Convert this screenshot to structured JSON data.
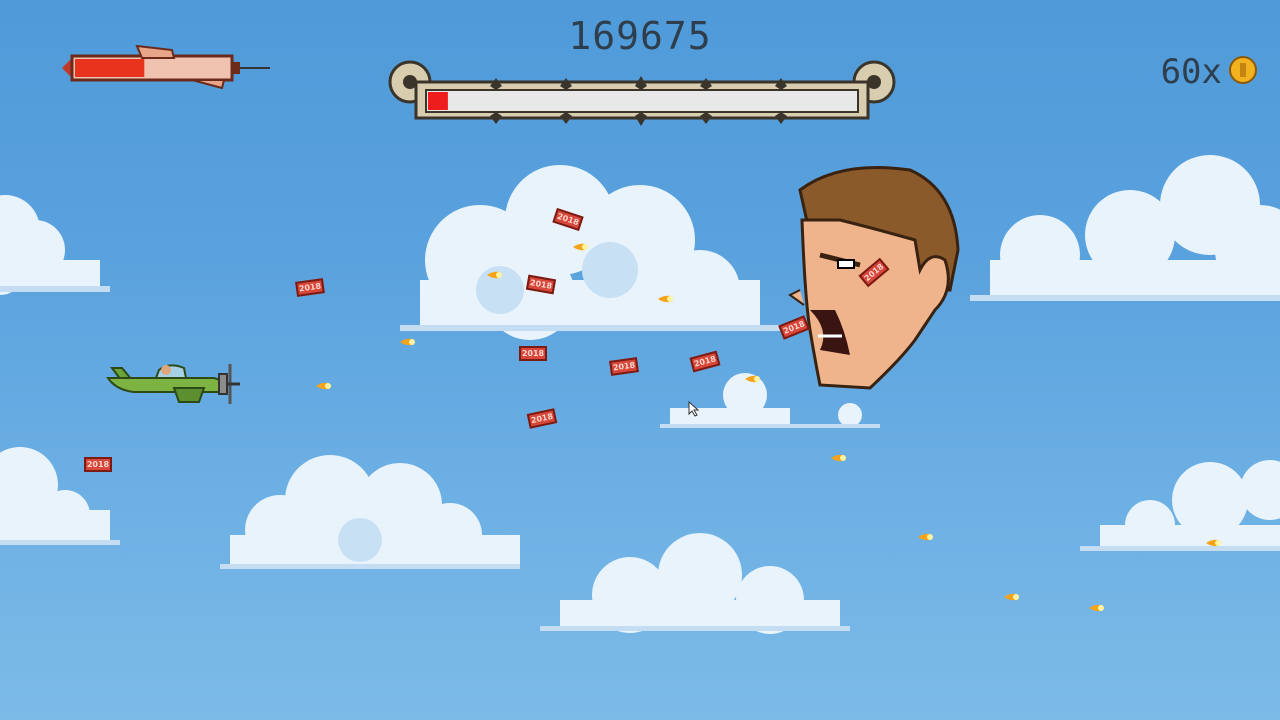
{
  "hud": {
    "score": "169675",
    "coins": "60x",
    "boss_health_fraction": 0.04,
    "player_power_fraction": 0.45
  },
  "projectiles": {
    "bill_text": "2018"
  },
  "icons": {
    "coin": "coin-icon",
    "syringe": "syringe-power-icon",
    "boss_bar": "bone-health-bar",
    "player": "green-propeller-plane",
    "boss": "giant-head-boss",
    "bullet": "fireball-bullet",
    "cursor": "mouse-cursor-icon"
  },
  "colors": {
    "sky": "#5aa2de",
    "cloud": "#e8f3fc",
    "cloud_shade": "#c4ddf2",
    "health_fill": "#ee1c1c",
    "syringe_fluid": "#e8341c",
    "text": "#2f3e4c",
    "bill": "#d9473a"
  }
}
